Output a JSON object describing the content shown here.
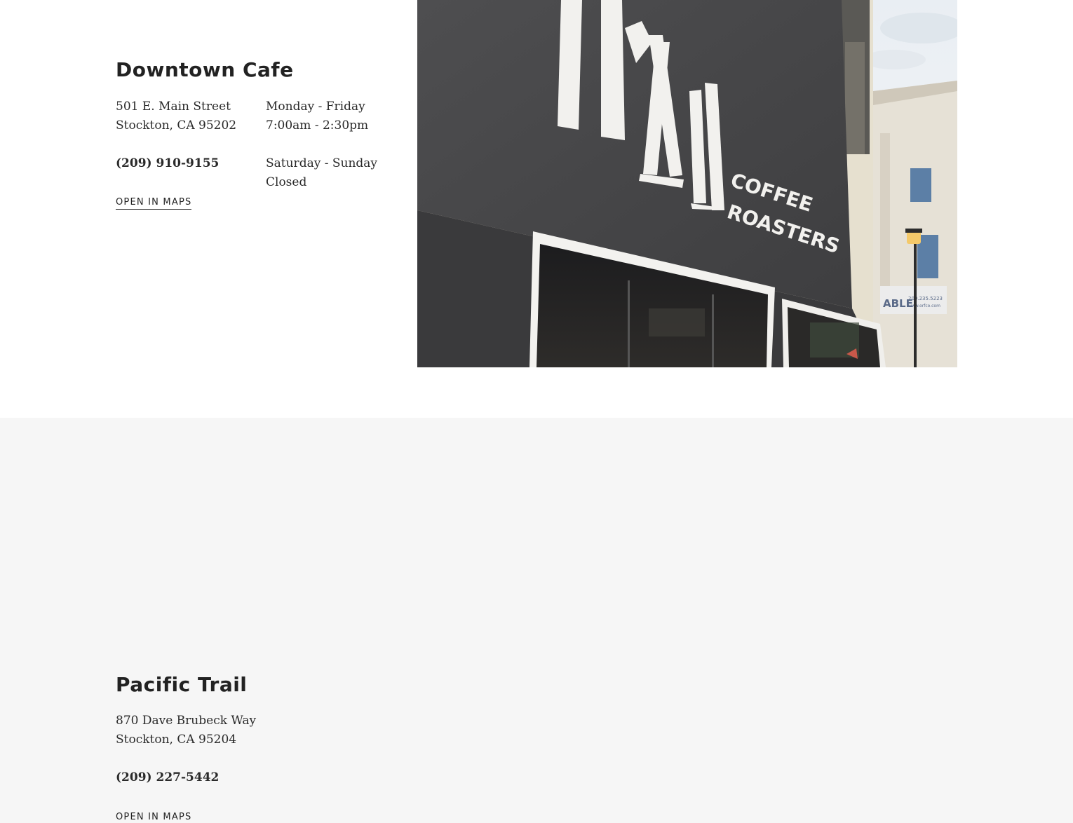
{
  "locations": [
    {
      "name": "Downtown Cafe",
      "address_line1": "501 E. Main Street",
      "address_line2": "Stockton, CA 95202",
      "phone": "(209) 910-9155",
      "maps_label": "OPEN IN MAPS",
      "hours": [
        {
          "days": "Monday - Friday",
          "time": "7:00am - 2:30pm"
        },
        {
          "days": "Saturday - Sunday",
          "time": "Closed"
        }
      ],
      "photo": {
        "sign_text": "TRAIL",
        "sign_sub_1": "COFFEE",
        "sign_sub_2": "ROASTERS",
        "banner_text": "ABLE",
        "banner_small_1": "209.235.5223",
        "banner_small_2": "www.orfco.com"
      }
    },
    {
      "name": "Pacific Trail",
      "address_line1": "870 Dave Brubeck Way",
      "address_line2": "Stockton, CA 95204",
      "phone": "(209) 227-5442",
      "maps_label": "OPEN IN MAPS"
    }
  ],
  "colors": {
    "text": "#222222",
    "alt_section_bg": "#f6f6f6",
    "wall": "#4a4a4c"
  }
}
